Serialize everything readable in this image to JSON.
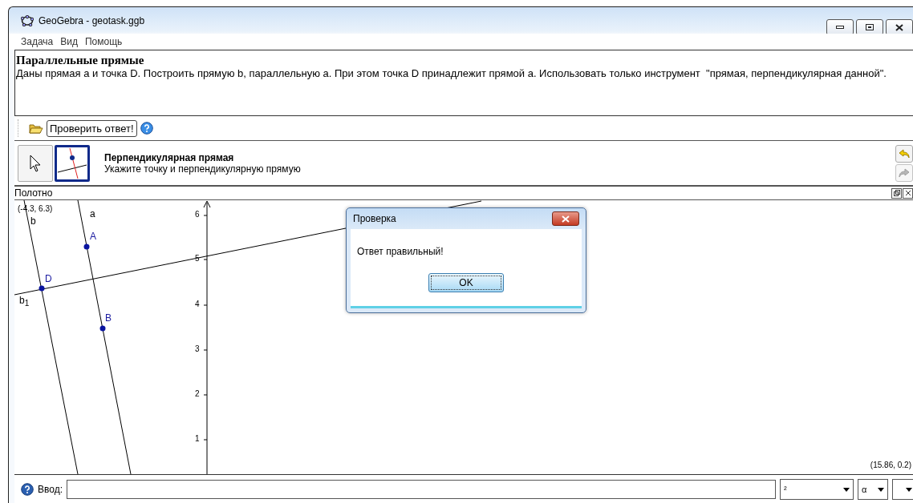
{
  "window": {
    "title": "GeoGebra - geotask.ggb"
  },
  "menu": [
    "Задача",
    "Вид",
    "Помощь"
  ],
  "task": {
    "title": "Параллельные прямые",
    "text": "Даны прямая a и точка D. Построить прямую b, параллельную a. При этом точка D принадлежит прямой a. Использовать только инструмент  \"прямая, перпендикулярная данной\"."
  },
  "toolbar": {
    "check_button": "Проверить ответ!"
  },
  "tools": [
    {
      "kind": "move",
      "selected": false
    },
    {
      "kind": "perpendicular",
      "selected": true
    }
  ],
  "active_tool": {
    "name": "Перпендикулярная прямая",
    "hint": "Укажите точку и перпендикулярную прямую"
  },
  "undo": {
    "disabled": false
  },
  "redo": {
    "disabled": true
  },
  "graphics": {
    "title": "Полотно",
    "corner_top_left": "(-4.3, 6.3)",
    "corner_bottom_right": "(15.86, 0.2)",
    "y_tick_labels": [
      "6",
      "5",
      "4",
      "3",
      "2",
      "1"
    ],
    "line_labels": [
      "b",
      "a",
      "b$_{1}$"
    ],
    "point_labels": [
      "A",
      "B",
      "D"
    ]
  },
  "dialog": {
    "title": "Проверка",
    "message": "Ответ правильный!",
    "button": "OK"
  },
  "input_bar": {
    "label": "Ввод:",
    "symbol_menus": [
      "²",
      "α"
    ]
  }
}
